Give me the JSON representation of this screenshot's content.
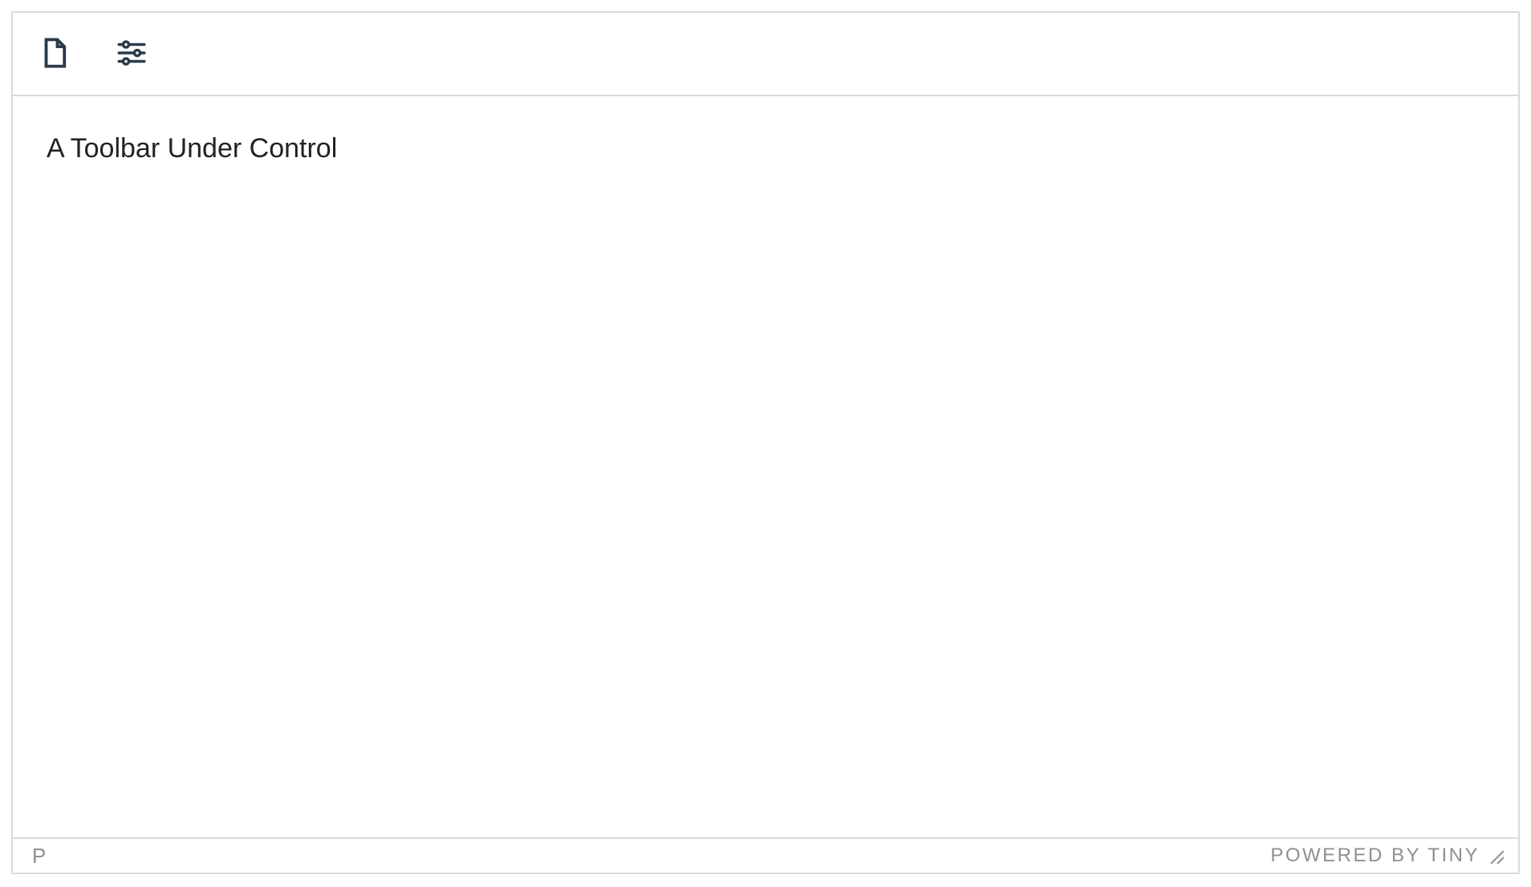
{
  "toolbar": {
    "buttons": [
      {
        "name": "new-document",
        "icon": "document-icon"
      },
      {
        "name": "settings",
        "icon": "sliders-icon"
      }
    ]
  },
  "content": {
    "text": "A Toolbar Under Control"
  },
  "statusbar": {
    "element_path": "P",
    "branding": "POWERED BY TINY"
  }
}
